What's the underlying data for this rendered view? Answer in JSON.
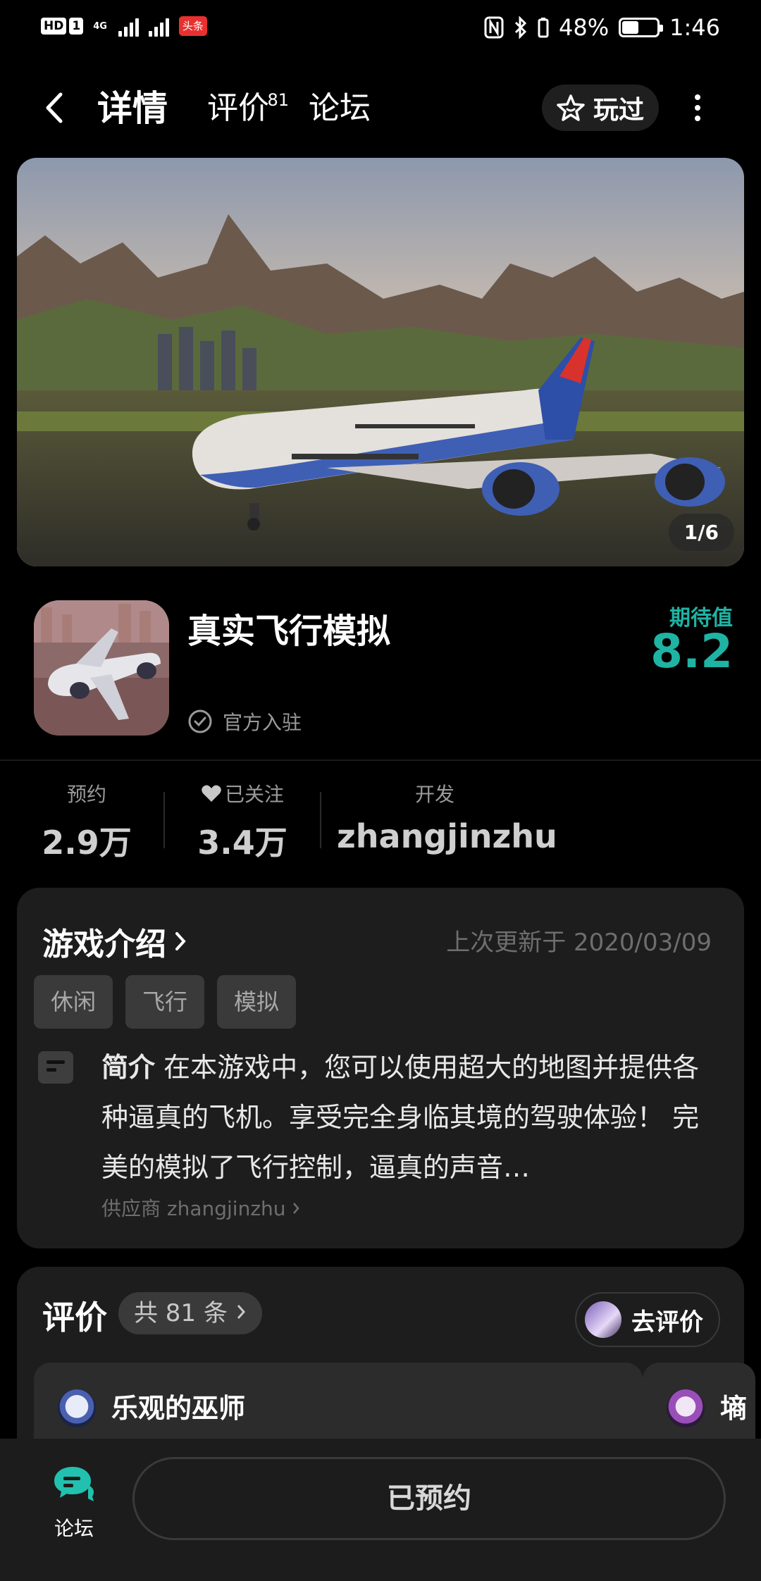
{
  "status_bar": {
    "hd_badges": [
      "HD",
      "1"
    ],
    "network": "4G",
    "news_app_badge": "头条",
    "battery": "48%",
    "battery_level": 0.48,
    "time": "1:46"
  },
  "nav": {
    "tabs": [
      {
        "label": "详情",
        "active": true
      },
      {
        "label": "评价",
        "badge": "81"
      },
      {
        "label": "论坛"
      }
    ],
    "played_label": "玩过"
  },
  "banner": {
    "page_indicator": "1/6"
  },
  "app": {
    "name": "真实飞行模拟",
    "official_label": "官方入驻",
    "expectation_label": "期待值",
    "expectation_value": "8.2"
  },
  "stats": [
    {
      "label": "预约",
      "value": "2.9万"
    },
    {
      "label": "已关注",
      "value": "3.4万"
    },
    {
      "label": "开发",
      "value": "zhangjinzhu"
    }
  ],
  "intro": {
    "title": "游戏介绍",
    "updated": "上次更新于 2020/03/09",
    "tags": [
      "休闲",
      "飞行",
      "模拟"
    ],
    "summary_label": "简介",
    "summary_text": "在本游戏中，您可以使用超大的地图并提供各种逼真的飞机。享受完全身临其境的驾驶体验！ 完美的模拟了飞行控制，逼真的声音…",
    "vendor": "供应商 zhangjinzhu"
  },
  "reviews": {
    "title": "评价",
    "count": "共 81 条",
    "go_review": "去评价",
    "cards": [
      {
        "author": "乐观的巫师"
      },
      {
        "author": "墒"
      }
    ]
  },
  "bottom": {
    "forum_label": "论坛",
    "reserve_label": "已预约"
  },
  "colors": {
    "accent": "#1fb3a4",
    "background": "#000000",
    "card": "#1d1d1d"
  }
}
